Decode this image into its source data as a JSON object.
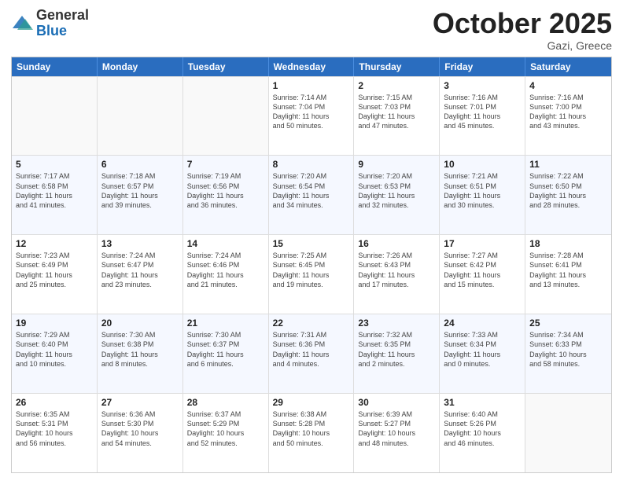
{
  "logo": {
    "general": "General",
    "blue": "Blue"
  },
  "header": {
    "month": "October 2025",
    "location": "Gazi, Greece"
  },
  "weekdays": [
    "Sunday",
    "Monday",
    "Tuesday",
    "Wednesday",
    "Thursday",
    "Friday",
    "Saturday"
  ],
  "rows": [
    [
      {
        "date": "",
        "info": ""
      },
      {
        "date": "",
        "info": ""
      },
      {
        "date": "",
        "info": ""
      },
      {
        "date": "1",
        "info": "Sunrise: 7:14 AM\nSunset: 7:04 PM\nDaylight: 11 hours\nand 50 minutes."
      },
      {
        "date": "2",
        "info": "Sunrise: 7:15 AM\nSunset: 7:03 PM\nDaylight: 11 hours\nand 47 minutes."
      },
      {
        "date": "3",
        "info": "Sunrise: 7:16 AM\nSunset: 7:01 PM\nDaylight: 11 hours\nand 45 minutes."
      },
      {
        "date": "4",
        "info": "Sunrise: 7:16 AM\nSunset: 7:00 PM\nDaylight: 11 hours\nand 43 minutes."
      }
    ],
    [
      {
        "date": "5",
        "info": "Sunrise: 7:17 AM\nSunset: 6:58 PM\nDaylight: 11 hours\nand 41 minutes."
      },
      {
        "date": "6",
        "info": "Sunrise: 7:18 AM\nSunset: 6:57 PM\nDaylight: 11 hours\nand 39 minutes."
      },
      {
        "date": "7",
        "info": "Sunrise: 7:19 AM\nSunset: 6:56 PM\nDaylight: 11 hours\nand 36 minutes."
      },
      {
        "date": "8",
        "info": "Sunrise: 7:20 AM\nSunset: 6:54 PM\nDaylight: 11 hours\nand 34 minutes."
      },
      {
        "date": "9",
        "info": "Sunrise: 7:20 AM\nSunset: 6:53 PM\nDaylight: 11 hours\nand 32 minutes."
      },
      {
        "date": "10",
        "info": "Sunrise: 7:21 AM\nSunset: 6:51 PM\nDaylight: 11 hours\nand 30 minutes."
      },
      {
        "date": "11",
        "info": "Sunrise: 7:22 AM\nSunset: 6:50 PM\nDaylight: 11 hours\nand 28 minutes."
      }
    ],
    [
      {
        "date": "12",
        "info": "Sunrise: 7:23 AM\nSunset: 6:49 PM\nDaylight: 11 hours\nand 25 minutes."
      },
      {
        "date": "13",
        "info": "Sunrise: 7:24 AM\nSunset: 6:47 PM\nDaylight: 11 hours\nand 23 minutes."
      },
      {
        "date": "14",
        "info": "Sunrise: 7:24 AM\nSunset: 6:46 PM\nDaylight: 11 hours\nand 21 minutes."
      },
      {
        "date": "15",
        "info": "Sunrise: 7:25 AM\nSunset: 6:45 PM\nDaylight: 11 hours\nand 19 minutes."
      },
      {
        "date": "16",
        "info": "Sunrise: 7:26 AM\nSunset: 6:43 PM\nDaylight: 11 hours\nand 17 minutes."
      },
      {
        "date": "17",
        "info": "Sunrise: 7:27 AM\nSunset: 6:42 PM\nDaylight: 11 hours\nand 15 minutes."
      },
      {
        "date": "18",
        "info": "Sunrise: 7:28 AM\nSunset: 6:41 PM\nDaylight: 11 hours\nand 13 minutes."
      }
    ],
    [
      {
        "date": "19",
        "info": "Sunrise: 7:29 AM\nSunset: 6:40 PM\nDaylight: 11 hours\nand 10 minutes."
      },
      {
        "date": "20",
        "info": "Sunrise: 7:30 AM\nSunset: 6:38 PM\nDaylight: 11 hours\nand 8 minutes."
      },
      {
        "date": "21",
        "info": "Sunrise: 7:30 AM\nSunset: 6:37 PM\nDaylight: 11 hours\nand 6 minutes."
      },
      {
        "date": "22",
        "info": "Sunrise: 7:31 AM\nSunset: 6:36 PM\nDaylight: 11 hours\nand 4 minutes."
      },
      {
        "date": "23",
        "info": "Sunrise: 7:32 AM\nSunset: 6:35 PM\nDaylight: 11 hours\nand 2 minutes."
      },
      {
        "date": "24",
        "info": "Sunrise: 7:33 AM\nSunset: 6:34 PM\nDaylight: 11 hours\nand 0 minutes."
      },
      {
        "date": "25",
        "info": "Sunrise: 7:34 AM\nSunset: 6:33 PM\nDaylight: 10 hours\nand 58 minutes."
      }
    ],
    [
      {
        "date": "26",
        "info": "Sunrise: 6:35 AM\nSunset: 5:31 PM\nDaylight: 10 hours\nand 56 minutes."
      },
      {
        "date": "27",
        "info": "Sunrise: 6:36 AM\nSunset: 5:30 PM\nDaylight: 10 hours\nand 54 minutes."
      },
      {
        "date": "28",
        "info": "Sunrise: 6:37 AM\nSunset: 5:29 PM\nDaylight: 10 hours\nand 52 minutes."
      },
      {
        "date": "29",
        "info": "Sunrise: 6:38 AM\nSunset: 5:28 PM\nDaylight: 10 hours\nand 50 minutes."
      },
      {
        "date": "30",
        "info": "Sunrise: 6:39 AM\nSunset: 5:27 PM\nDaylight: 10 hours\nand 48 minutes."
      },
      {
        "date": "31",
        "info": "Sunrise: 6:40 AM\nSunset: 5:26 PM\nDaylight: 10 hours\nand 46 minutes."
      },
      {
        "date": "",
        "info": ""
      }
    ]
  ]
}
